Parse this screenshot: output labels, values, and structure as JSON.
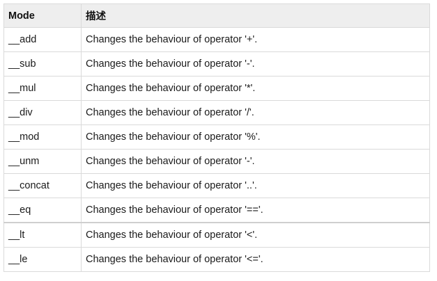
{
  "table": {
    "headers": [
      "Mode",
      "描述"
    ],
    "rows": [
      {
        "mode": "__add",
        "desc": "Changes the behaviour of operator '+'."
      },
      {
        "mode": "__sub",
        "desc": "Changes the behaviour of operator '-'."
      },
      {
        "mode": "__mul",
        "desc": "Changes the behaviour of operator '*'."
      },
      {
        "mode": "__div",
        "desc": "Changes the behaviour of operator '/'."
      },
      {
        "mode": "__mod",
        "desc": "Changes the behaviour of operator '%'."
      },
      {
        "mode": "__unm",
        "desc": "Changes the behaviour of operator '-'."
      },
      {
        "mode": "__concat",
        "desc": "Changes the behaviour of operator '..'."
      },
      {
        "mode": "__eq",
        "desc": "Changes the behaviour of operator '=='."
      },
      {
        "mode": "__lt",
        "desc": "Changes the behaviour of operator '<'."
      },
      {
        "mode": "__le",
        "desc": "Changes the behaviour of operator '<='."
      }
    ]
  }
}
